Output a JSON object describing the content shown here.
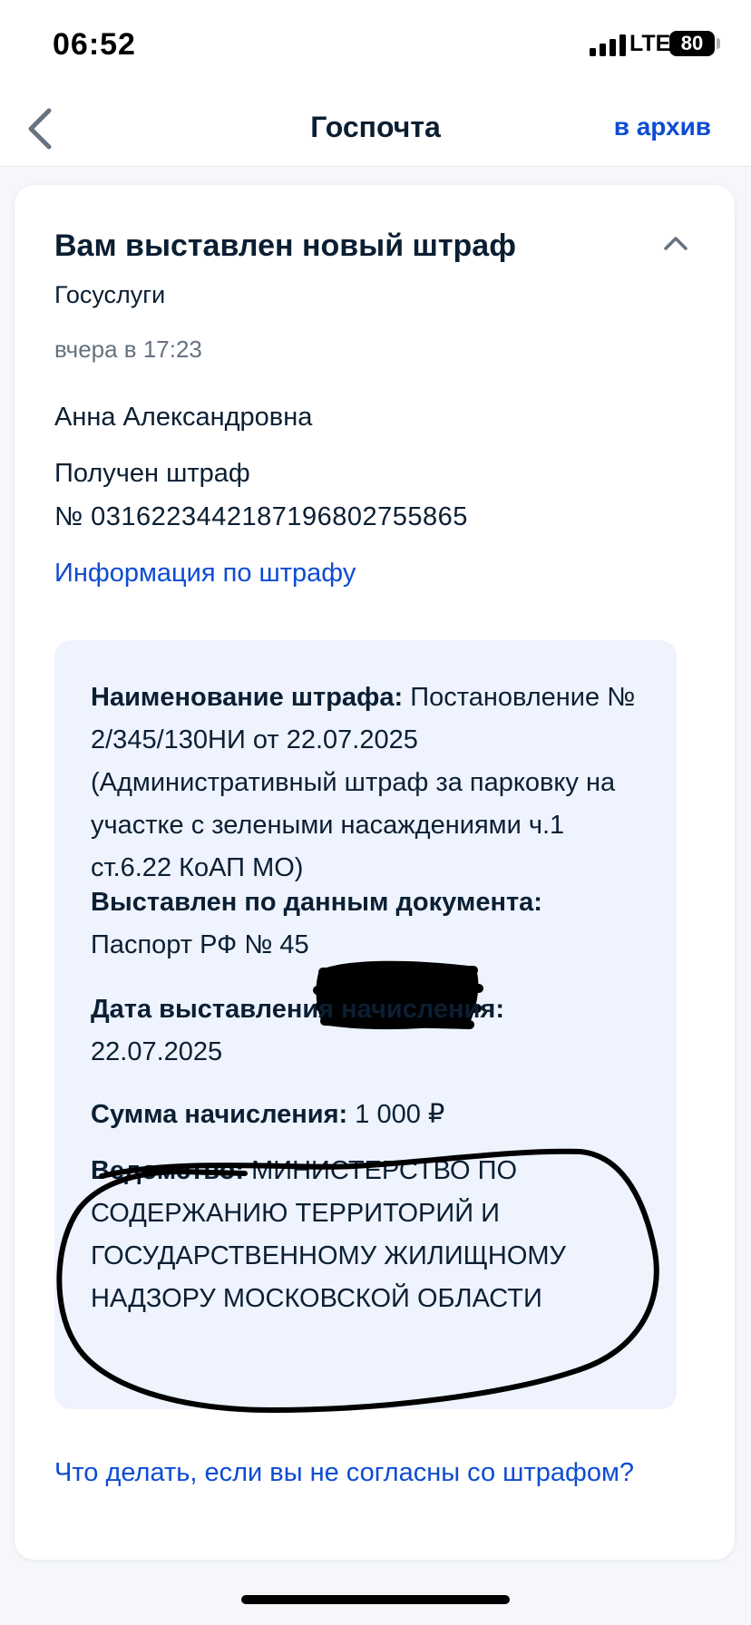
{
  "status_bar": {
    "time": "06:52",
    "network": "LTE",
    "battery": "80"
  },
  "nav": {
    "title": "Госпочта",
    "archive_label": "в архив",
    "back_icon": "chevron-left-icon"
  },
  "message": {
    "title": "Вам выставлен новый штраф",
    "sender": "Госуслуги",
    "date": "вчера в 17:23",
    "greeting": "Анна Александровна",
    "fine_label": "Получен штраф",
    "fine_number": "№ 0316223442187196802755865",
    "info_link": "Информация по штрафу",
    "collapse_icon": "chevron-up-icon"
  },
  "details": {
    "name_label": "Наименование штрафа:",
    "name_value": "Постановление № 2/345/130НИ от 22.07.2025 (Административный штраф за парковку на участке с зелеными насаждениями ч.1 ст.6.22 КоАП МО)",
    "document_label": "Выставлен по данным документа:",
    "document_value": "Паспорт РФ № 45",
    "date_label": "Дата выставления начисления:",
    "date_value": "22.07.2025",
    "amount_label": "Сумма начисления:",
    "amount_value": "1 000 ₽",
    "agency_label": "Ведомство:",
    "agency_value": "МИНИСТЕРСТВО ПО СОДЕРЖАНИЮ ТЕРРИТОРИЙ И ГОСУДАРСТВЕННОМУ ЖИЛИЩНОМУ НАДЗОРУ МОСКОВСКОЙ ОБЛАСТИ"
  },
  "disagree_link": "Что делать, если вы не согласны со штрафом?",
  "colors": {
    "accent": "#0d4cd3",
    "details_bg": "#eef3fe",
    "text": "#0b1f33",
    "muted": "#66727f"
  }
}
